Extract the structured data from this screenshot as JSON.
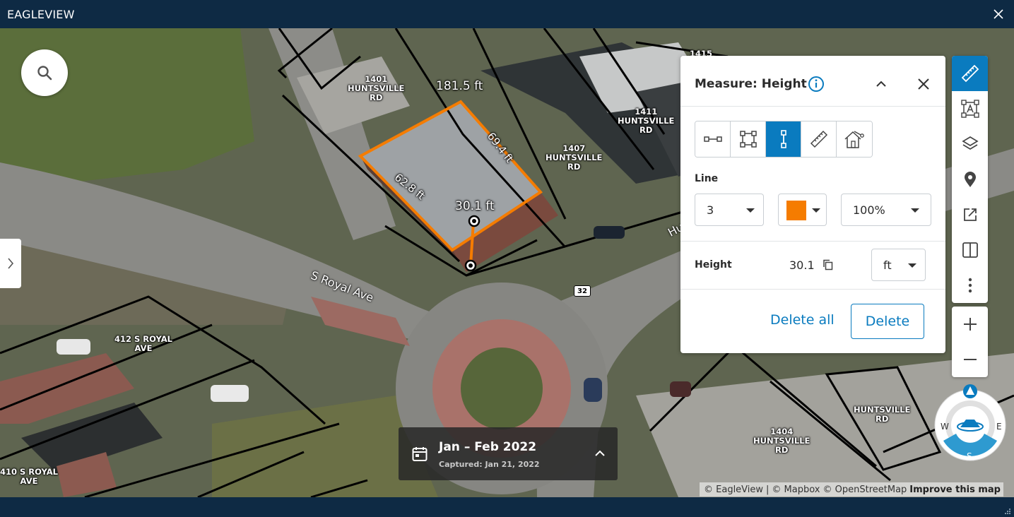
{
  "window": {
    "title": "EAGLEVIEW"
  },
  "map": {
    "parcel_labels": [
      "1401\nHUNTSVILLE\nRD",
      "1411\nHUNTSVILLE\nRD",
      "1407\nHUNTSVILLE\nRD",
      "1415",
      "412 S ROYAL\nAVE",
      "410 S ROYAL\nAVE",
      "HUNTSVILLE\nRD",
      "1404\nHUNTSVILLE\nRD"
    ],
    "road_labels": [
      "S Royal Ave",
      "Hu"
    ],
    "route_shield": "32",
    "measurements": [
      "181.5 ft",
      "69.4 ft",
      "62.8 ft",
      "30.1 ft"
    ],
    "measure_color": "#f57c00"
  },
  "measure_panel": {
    "title": "Measure: Height",
    "tools": [
      "line-distance-icon",
      "area-icon",
      "height-icon",
      "ruler-icon",
      "roof-pitch-icon"
    ],
    "active_tool": "height-icon",
    "line_section_label": "Line",
    "line_width": "3",
    "line_color": "#f57c00",
    "line_opacity": "100%",
    "height_label": "Height",
    "height_value": "30.1",
    "unit": "ft",
    "delete_all_label": "Delete all",
    "delete_label": "Delete"
  },
  "right_toolbar": {
    "items": [
      "measure-icon",
      "annotate-icon",
      "layers-icon",
      "location-pin-icon",
      "share-icon",
      "split-view-icon",
      "more-icon"
    ],
    "active": "measure-icon",
    "zoom": [
      "zoom-in-icon",
      "zoom-out-icon"
    ]
  },
  "compass": {
    "n": "",
    "w": "W",
    "e": "E",
    "s": "S"
  },
  "date_card": {
    "period": "Jan – Feb 2022",
    "captured": "Captured: Jan 21, 2022"
  },
  "attribution": {
    "eagleview": "© EagleView",
    "sep": "|",
    "mapbox": "© Mapbox",
    "osm": "© OpenStreetMap",
    "improve": "Improve this map"
  },
  "colors": {
    "accent": "#0a7bbf",
    "titlebar": "#0e2a44"
  }
}
